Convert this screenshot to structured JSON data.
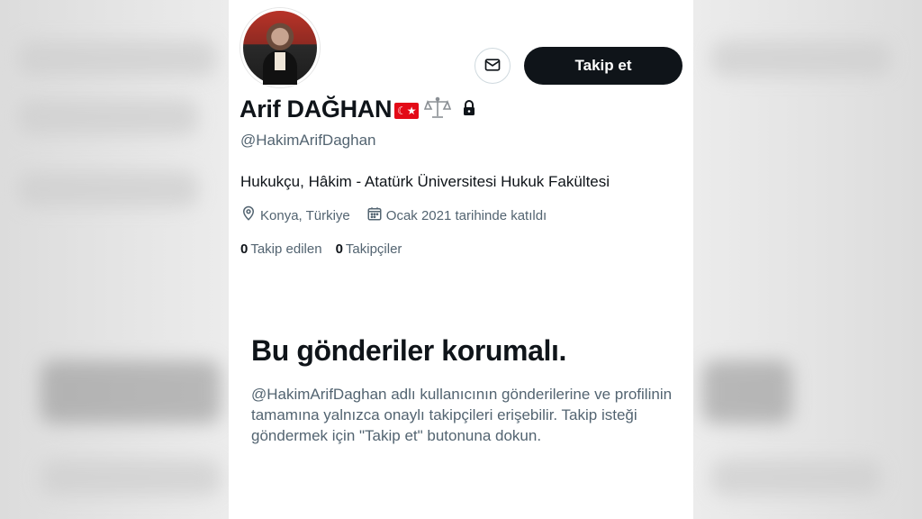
{
  "profile": {
    "display_name": "Arif DAĞHAN",
    "handle": "@HakimArifDaghan",
    "bio": "Hukukçu, Hâkim - Atatürk Üniversitesi Hukuk Fakültesi",
    "location": "Konya, Türkiye",
    "joined": "Ocak 2021 tarihinde katıldı",
    "following_count": "0",
    "following_label": "Takip edilen",
    "followers_count": "0",
    "followers_label": "Takipçiler"
  },
  "actions": {
    "follow_label": "Takip et"
  },
  "icons": {
    "message": "envelope-icon",
    "flag": "turkey-flag-icon",
    "scales": "scales-icon",
    "lock": "lock-icon",
    "location": "location-pin-icon",
    "calendar": "calendar-icon"
  },
  "protected": {
    "title": "Bu gönderiler korumalı.",
    "description": "@HakimArifDaghan adlı kullanıcının gönderilerine ve profilinin tamamına yalnızca onaylı takipçileri erişebilir. Takip isteği göndermek için \"Takip et\" butonuna dokun."
  },
  "colors": {
    "primary_text": "#0f1419",
    "secondary_text": "#536471",
    "follow_button_bg": "#0f1419",
    "flag_red": "#e30a17"
  }
}
